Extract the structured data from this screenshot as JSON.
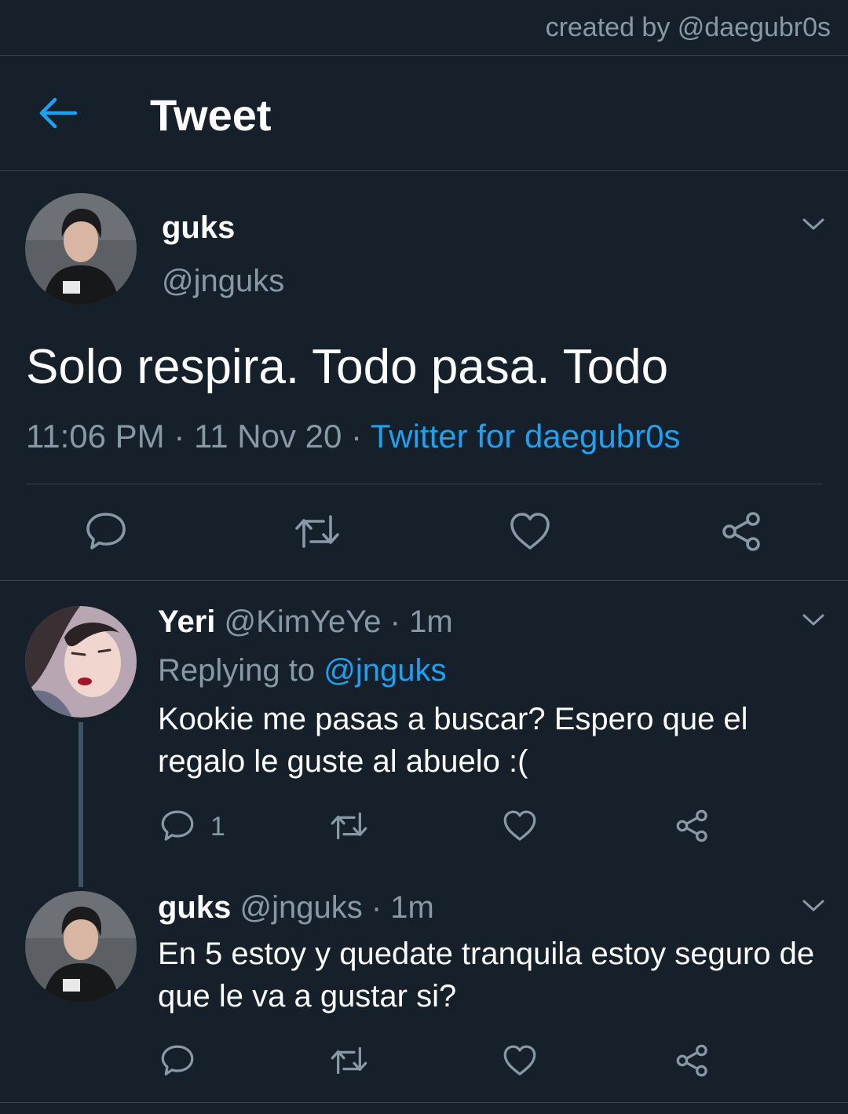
{
  "credit": "created by @daegubr0s",
  "header": {
    "title": "Tweet",
    "back_icon": "arrow-left-icon",
    "accent": "#1da1f2"
  },
  "main_tweet": {
    "name": "guks",
    "handle": "@jnguks",
    "text": "Solo respira. Todo pasa. Todo",
    "time": "11:06 PM",
    "date": "11 Nov 20",
    "source": "Twitter for daegubr0s",
    "icons": [
      "reply-icon",
      "retweet-icon",
      "like-icon",
      "share-icon"
    ]
  },
  "replies": [
    {
      "name": "Yeri",
      "handle": "@KimYeYe",
      "age": "1m",
      "replying_prefix": "Replying to",
      "replying_to": "@jnguks",
      "text": "Kookie me pasas a buscar? Espero que el regalo le guste al abuelo :(",
      "reply_count": "1"
    },
    {
      "name": "guks",
      "handle": "@jnguks",
      "age": "1m",
      "text": "En 5 estoy y quedate tranquila estoy seguro de que le va a gustar si?"
    }
  ],
  "colors": {
    "background": "#15202b",
    "muted": "#8899a6",
    "link": "#1da1f2",
    "divider": "#38444d"
  }
}
